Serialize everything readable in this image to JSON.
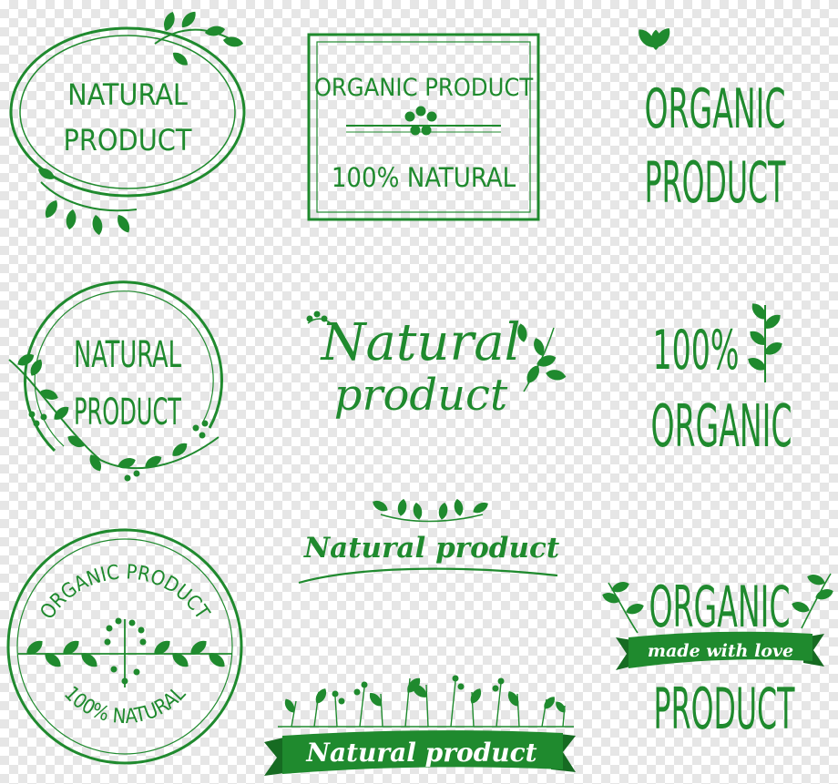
{
  "accent_color": "#1f8a2e",
  "badges": {
    "b1": {
      "line1": "NATURAL",
      "line2": "PRODUCT"
    },
    "b2": {
      "line1": "ORGANIC PRODUCT",
      "line2": "100% NATURAL"
    },
    "b3": {
      "line1": "ORGANIC",
      "line2": "PRODUCT"
    },
    "b4": {
      "line1": "NATURAL",
      "line2": "PRODUCT"
    },
    "b5": {
      "line1": "Natural",
      "line2": "product"
    },
    "b6": {
      "line1": "100%",
      "line2": "ORGANIC"
    },
    "b7": {
      "line1": "ORGANIC PRODUCT",
      "line2": "100% NATURAL"
    },
    "b8": {
      "text": "Natural product"
    },
    "b9": {
      "line1": "ORGANIC",
      "ribbon": "made with love",
      "line2": "PRODUCT"
    },
    "b10": {
      "ribbon": "Natural product"
    }
  }
}
